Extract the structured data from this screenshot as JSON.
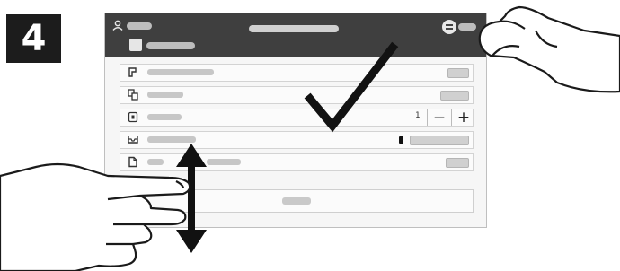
{
  "step": {
    "number": "4"
  },
  "header": {
    "user_name": "",
    "center_title": "",
    "job_label": "",
    "menu_label": ""
  },
  "rows": [
    {
      "icon": "printer-icon",
      "label": "",
      "value": ""
    },
    {
      "icon": "copies-icon",
      "label": "",
      "value": ""
    },
    {
      "icon": "quantity-icon",
      "label": "",
      "quantity": "1",
      "minus": "−",
      "plus": "+"
    },
    {
      "icon": "tray-icon",
      "label": "",
      "value": ""
    },
    {
      "icon": "document-icon",
      "label": "",
      "extra": "",
      "value": ""
    }
  ],
  "main_button": {
    "label": ""
  },
  "overlay_icons": [
    "checkmark-icon",
    "up-down-arrow-icon",
    "right-hand-icon",
    "left-hand-icon"
  ]
}
